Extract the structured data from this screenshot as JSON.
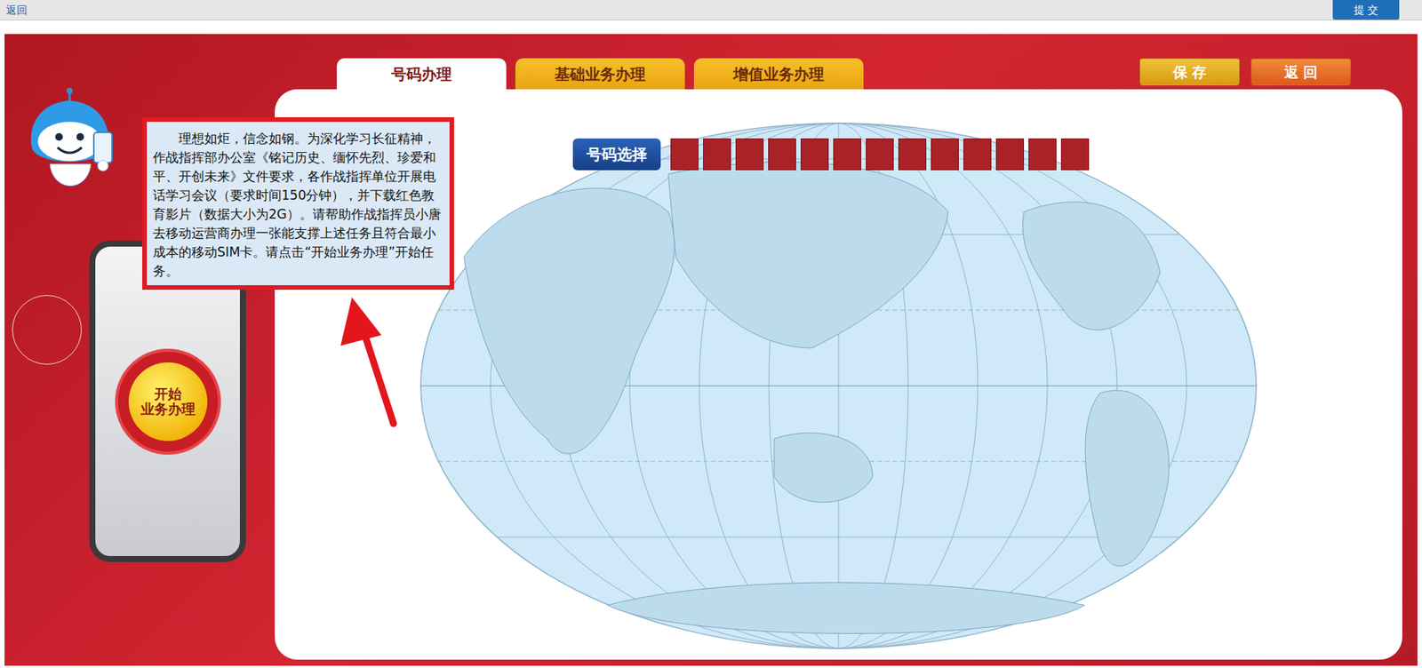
{
  "top_bar": {
    "back": "返回",
    "submit": "提 交"
  },
  "tabs": [
    {
      "label": "号码办理",
      "selected": true
    },
    {
      "label": "基础业务办理",
      "selected": false
    },
    {
      "label": "增值业务办理",
      "selected": false
    }
  ],
  "buttons": [
    {
      "label": "保 存"
    },
    {
      "label": "返 回"
    }
  ],
  "instruction": "理想如炬，信念如钢。为深化学习长征精神，作战指挥部办公室《铭记历史、缅怀先烈、珍爱和平、开创未来》文件要求，各作战指挥单位开展电话学习会议（要求时间150分钟），并下载红色教育影片（数据大小为2G）。请帮助作战指挥员小唐去移动运营商办理一张能支撑上述任务且符合最小成本的移动SIM卡。请点击“开始业务办理”开始任务。",
  "start_button": {
    "lines": [
      "开始",
      "业务办理"
    ]
  },
  "number_selection": {
    "label": "号码选择",
    "slots": [
      {
        "filled": false
      },
      {
        "filled": false
      },
      {
        "filled": false
      },
      {
        "filled": false
      },
      {
        "filled": false
      },
      {
        "filled": false
      },
      {
        "filled": false
      },
      {
        "filled": false
      },
      {
        "filled": false
      },
      {
        "filled": false
      },
      {
        "filled": false
      },
      {
        "filled": false
      },
      {
        "filled": false
      }
    ]
  }
}
